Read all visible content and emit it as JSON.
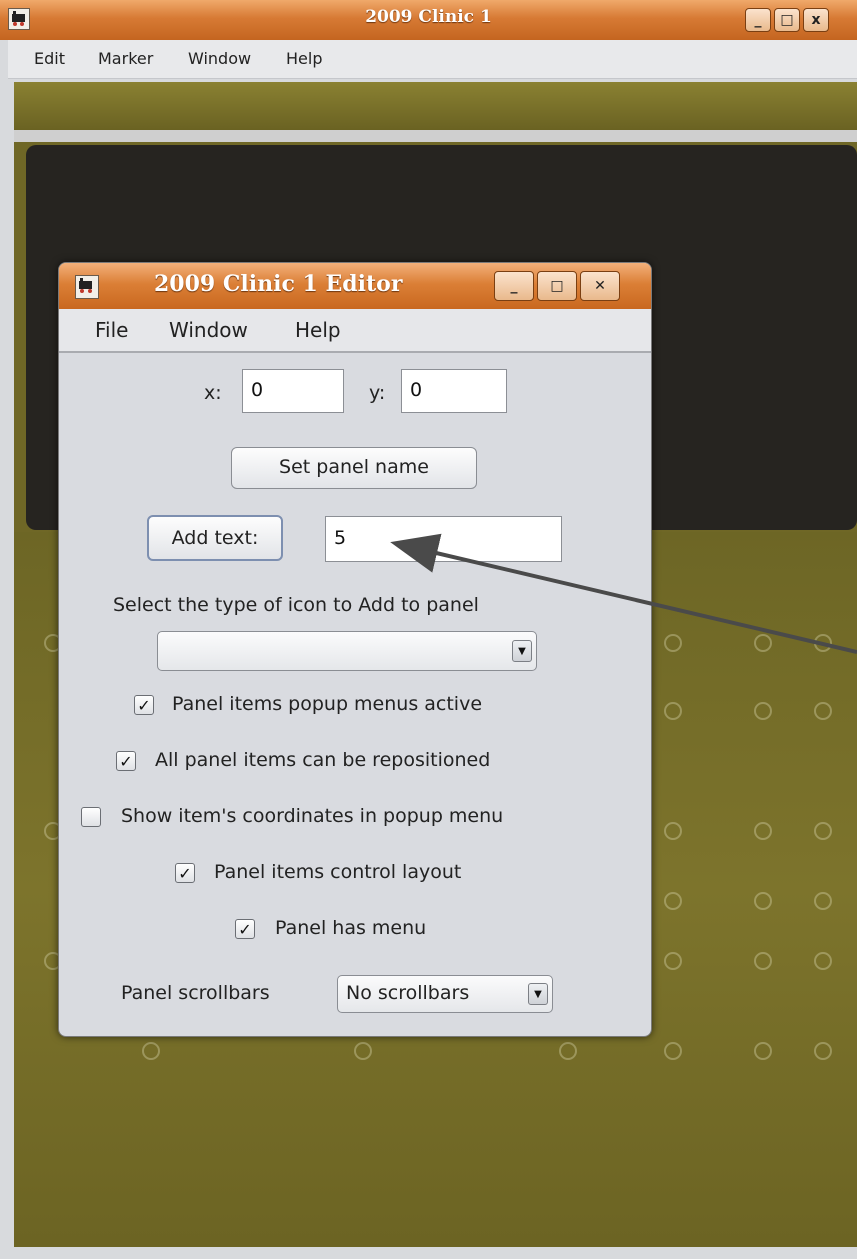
{
  "main_window": {
    "title": "2009 Clinic 1",
    "menu": [
      "Edit",
      "Marker",
      "Window",
      "Help"
    ],
    "buttons": {
      "minimize": "_",
      "maximize": "□",
      "close": "x"
    }
  },
  "editor": {
    "title": "2009 Clinic 1 Editor",
    "menu": [
      "File",
      "Window",
      "Help"
    ],
    "buttons": {
      "minimize": "_",
      "maximize": "□",
      "close": "✕"
    },
    "x_label": "x:",
    "x_value": "0",
    "y_label": "y:",
    "y_value": "0",
    "set_panel_name_label": "Set panel name",
    "add_text_label": "Add text:",
    "add_text_value": "5",
    "icon_type_label": "Select the type of icon to Add to panel",
    "icon_type_value": "",
    "checkboxes": [
      {
        "label": "Panel items popup menus active",
        "checked": true
      },
      {
        "label": "All panel items can be repositioned",
        "checked": true
      },
      {
        "label": "Show item's coordinates in popup menu",
        "checked": false
      },
      {
        "label": "Panel items control layout",
        "checked": true
      },
      {
        "label": "Panel has menu",
        "checked": true
      }
    ],
    "scrollbars_label": "Panel scrollbars",
    "scrollbars_value": "No scrollbars"
  },
  "colors": {
    "titlebar": "#d77a34",
    "panel_olive": "#756d28",
    "panel_dark": "#262420",
    "window_bg": "#d9dbe0"
  }
}
